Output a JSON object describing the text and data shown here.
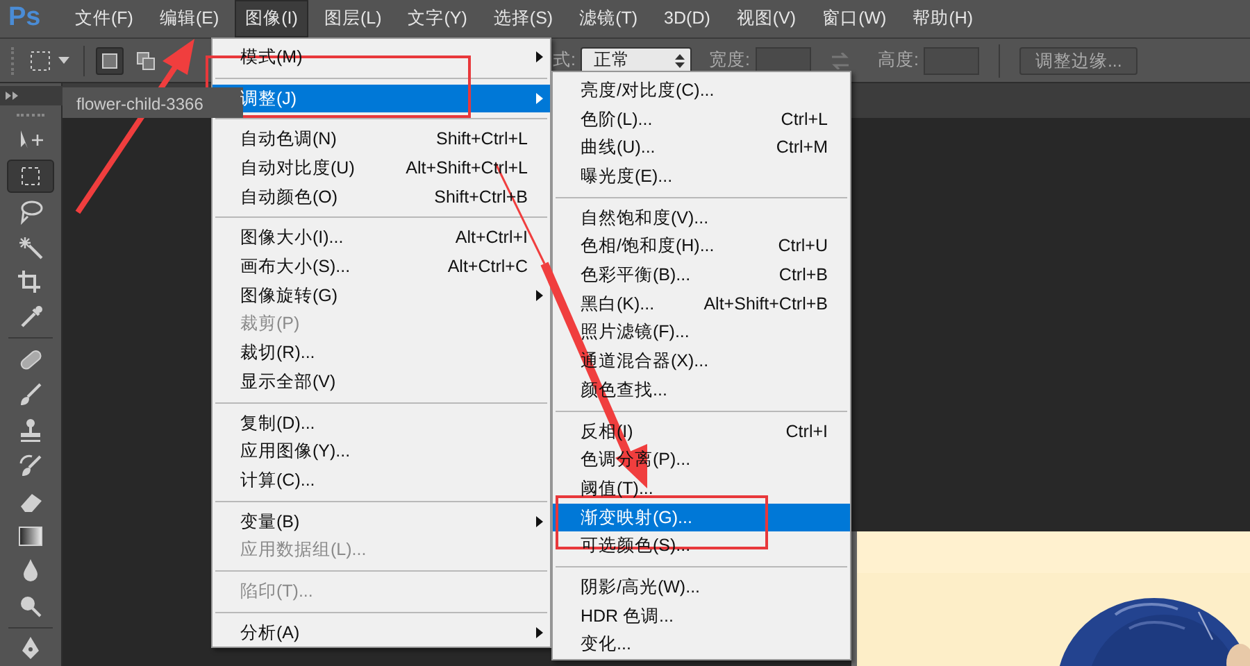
{
  "menu_bar": {
    "logo": "Ps",
    "items": [
      {
        "label": "文件(F)",
        "open": false
      },
      {
        "label": "编辑(E)",
        "open": false
      },
      {
        "label": "图像(I)",
        "open": true
      },
      {
        "label": "图层(L)",
        "open": false
      },
      {
        "label": "文字(Y)",
        "open": false
      },
      {
        "label": "选择(S)",
        "open": false
      },
      {
        "label": "滤镜(T)",
        "open": false
      },
      {
        "label": "3D(D)",
        "open": false
      },
      {
        "label": "视图(V)",
        "open": false
      },
      {
        "label": "窗口(W)",
        "open": false
      },
      {
        "label": "帮助(H)",
        "open": false
      }
    ]
  },
  "options_bar": {
    "modes": [
      {
        "kind": "new",
        "selected": true
      },
      {
        "kind": "add",
        "selected": false
      }
    ],
    "style_label": "式:",
    "style_value": "正常",
    "width_label": "宽度:",
    "height_label": "高度:",
    "refine_button": {
      "label": "调整边缘...",
      "disabled": true
    }
  },
  "document_tab": {
    "title": "flower-child-3366"
  },
  "tools": [
    {
      "kind": "move",
      "selected": false
    },
    {
      "kind": "marquee",
      "selected": true
    },
    {
      "kind": "lasso",
      "selected": false
    },
    {
      "kind": "wand",
      "selected": false
    },
    {
      "kind": "crop",
      "selected": false
    },
    {
      "kind": "eyedropper",
      "selected": false
    },
    {
      "kind": "separator"
    },
    {
      "kind": "bandage",
      "selected": false
    },
    {
      "kind": "brush",
      "selected": false
    },
    {
      "kind": "stamp",
      "selected": false
    },
    {
      "kind": "history",
      "selected": false
    },
    {
      "kind": "eraser",
      "selected": false
    },
    {
      "kind": "gradient",
      "selected": false
    },
    {
      "kind": "drop",
      "selected": false
    },
    {
      "kind": "dodge",
      "selected": false
    },
    {
      "kind": "separator"
    },
    {
      "kind": "pen",
      "selected": false
    }
  ],
  "image_menu": {
    "items": [
      {
        "kind": "item",
        "label": "模式(M)",
        "submenu": true,
        "disabled": false,
        "selected": false
      },
      {
        "kind": "separator"
      },
      {
        "kind": "item",
        "label": "调整(J)",
        "submenu": true,
        "disabled": false,
        "selected": true
      },
      {
        "kind": "separator"
      },
      {
        "kind": "item",
        "label": "自动色调(N)",
        "shortcut": "Shift+Ctrl+L",
        "submenu": false,
        "disabled": false,
        "selected": false
      },
      {
        "kind": "item",
        "label": "自动对比度(U)",
        "shortcut": "Alt+Shift+Ctrl+L",
        "submenu": false,
        "disabled": false,
        "selected": false
      },
      {
        "kind": "item",
        "label": "自动颜色(O)",
        "shortcut": "Shift+Ctrl+B",
        "submenu": false,
        "disabled": false,
        "selected": false
      },
      {
        "kind": "separator"
      },
      {
        "kind": "item",
        "label": "图像大小(I)...",
        "shortcut": "Alt+Ctrl+I",
        "submenu": false,
        "disabled": false,
        "selected": false
      },
      {
        "kind": "item",
        "label": "画布大小(S)...",
        "shortcut": "Alt+Ctrl+C",
        "submenu": false,
        "disabled": false,
        "selected": false
      },
      {
        "kind": "item",
        "label": "图像旋转(G)",
        "submenu": true,
        "disabled": false,
        "selected": false
      },
      {
        "kind": "item",
        "label": "裁剪(P)",
        "submenu": false,
        "disabled": true,
        "selected": false
      },
      {
        "kind": "item",
        "label": "裁切(R)...",
        "submenu": false,
        "disabled": false,
        "selected": false
      },
      {
        "kind": "item",
        "label": "显示全部(V)",
        "submenu": false,
        "disabled": false,
        "selected": false
      },
      {
        "kind": "separator"
      },
      {
        "kind": "item",
        "label": "复制(D)...",
        "submenu": false,
        "disabled": false,
        "selected": false
      },
      {
        "kind": "item",
        "label": "应用图像(Y)...",
        "submenu": false,
        "disabled": false,
        "selected": false
      },
      {
        "kind": "item",
        "label": "计算(C)...",
        "submenu": false,
        "disabled": false,
        "selected": false
      },
      {
        "kind": "separator"
      },
      {
        "kind": "item",
        "label": "变量(B)",
        "submenu": true,
        "disabled": false,
        "selected": false
      },
      {
        "kind": "item",
        "label": "应用数据组(L)...",
        "submenu": false,
        "disabled": true,
        "selected": false
      },
      {
        "kind": "separator"
      },
      {
        "kind": "item",
        "label": "陷印(T)...",
        "submenu": false,
        "disabled": true,
        "selected": false
      },
      {
        "kind": "separator"
      },
      {
        "kind": "item",
        "label": "分析(A)",
        "submenu": true,
        "disabled": false,
        "selected": false
      }
    ]
  },
  "adjust_submenu": {
    "items": [
      {
        "kind": "item",
        "label": "亮度/对比度(C)...",
        "submenu": false,
        "disabled": false,
        "selected": false
      },
      {
        "kind": "item",
        "label": "色阶(L)...",
        "shortcut": "Ctrl+L",
        "submenu": false,
        "disabled": false,
        "selected": false
      },
      {
        "kind": "item",
        "label": "曲线(U)...",
        "shortcut": "Ctrl+M",
        "submenu": false,
        "disabled": false,
        "selected": false
      },
      {
        "kind": "item",
        "label": "曝光度(E)...",
        "submenu": false,
        "disabled": false,
        "selected": false
      },
      {
        "kind": "separator"
      },
      {
        "kind": "item",
        "label": "自然饱和度(V)...",
        "submenu": false,
        "disabled": false,
        "selected": false
      },
      {
        "kind": "item",
        "label": "色相/饱和度(H)...",
        "shortcut": "Ctrl+U",
        "submenu": false,
        "disabled": false,
        "selected": false
      },
      {
        "kind": "item",
        "label": "色彩平衡(B)...",
        "shortcut": "Ctrl+B",
        "submenu": false,
        "disabled": false,
        "selected": false
      },
      {
        "kind": "item",
        "label": "黑白(K)...",
        "shortcut": "Alt+Shift+Ctrl+B",
        "submenu": false,
        "disabled": false,
        "selected": false
      },
      {
        "kind": "item",
        "label": "照片滤镜(F)...",
        "submenu": false,
        "disabled": false,
        "selected": false
      },
      {
        "kind": "item",
        "label": "通道混合器(X)...",
        "submenu": false,
        "disabled": false,
        "selected": false
      },
      {
        "kind": "item",
        "label": "颜色查找...",
        "submenu": false,
        "disabled": false,
        "selected": false
      },
      {
        "kind": "separator"
      },
      {
        "kind": "item",
        "label": "反相(I)",
        "shortcut": "Ctrl+I",
        "submenu": false,
        "disabled": false,
        "selected": false
      },
      {
        "kind": "item",
        "label": "色调分离(P)...",
        "submenu": false,
        "disabled": false,
        "selected": false
      },
      {
        "kind": "item",
        "label": "阈值(T)...",
        "submenu": false,
        "disabled": false,
        "selected": false
      },
      {
        "kind": "item",
        "label": "渐变映射(G)...",
        "submenu": false,
        "disabled": false,
        "selected": true
      },
      {
        "kind": "item",
        "label": "可选颜色(S)...",
        "submenu": false,
        "disabled": false,
        "selected": false
      },
      {
        "kind": "separator"
      },
      {
        "kind": "item",
        "label": "阴影/高光(W)...",
        "submenu": false,
        "disabled": false,
        "selected": false
      },
      {
        "kind": "item",
        "label": "HDR 色调...",
        "submenu": false,
        "disabled": false,
        "selected": false
      },
      {
        "kind": "item",
        "label": "变化...",
        "submenu": false,
        "disabled": false,
        "selected": false
      }
    ]
  }
}
